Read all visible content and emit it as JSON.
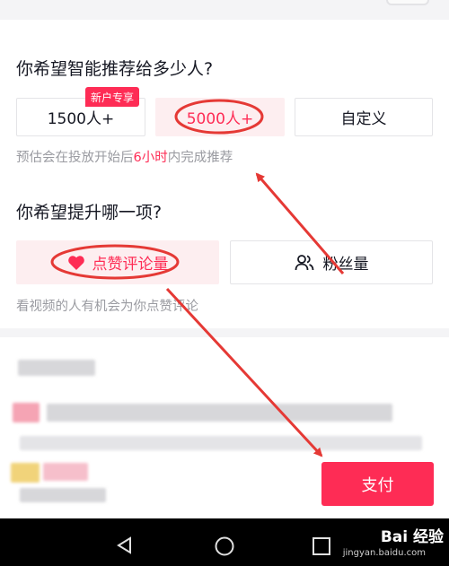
{
  "question_audience": "你希望智能推荐给多少人?",
  "audience_options": [
    {
      "label": "1500人+",
      "selected": false
    },
    {
      "label": "5000人+",
      "selected": true
    },
    {
      "label": "自定义",
      "selected": false
    }
  ],
  "new_user_badge": "新户专享",
  "estimate_hint": {
    "prefix": "预估会在投放开始后",
    "highlight": "6小时",
    "suffix": "内完成推荐"
  },
  "question_boost": "你希望提升哪一项?",
  "boost_options": [
    {
      "label": "点赞评论量",
      "icon": "heart-icon",
      "selected": true
    },
    {
      "label": "粉丝量",
      "icon": "users-icon",
      "selected": false
    }
  ],
  "boost_hint": "看视频的人有机会为你点赞评论",
  "pay_button": "支付",
  "watermark": "Bai 经验",
  "watermark_url": "jingyan.baidu.com",
  "colors": {
    "accent": "#fe2c55",
    "selected_bg": "#fdeef0",
    "annotation": "#e53935"
  }
}
